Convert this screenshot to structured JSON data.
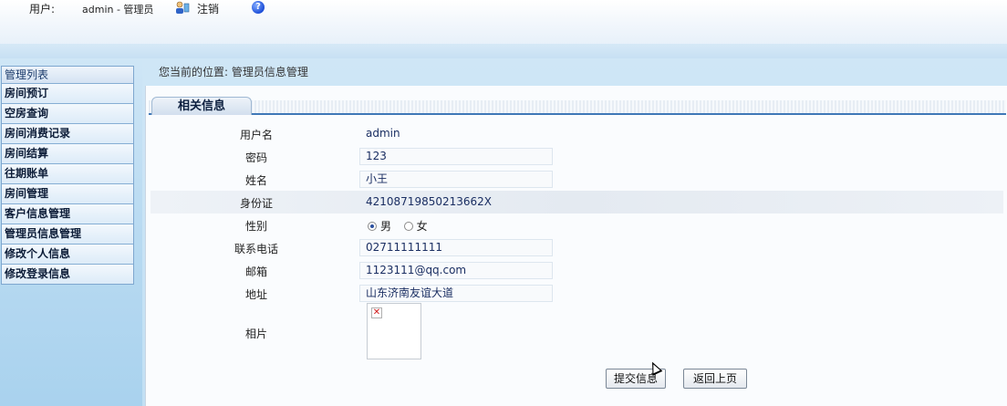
{
  "header": {
    "user_label": "用户:",
    "user_value": "admin - 管理员",
    "logout_label": "注销",
    "help_glyph": "?"
  },
  "sidebar": {
    "title": "管理列表",
    "items": [
      {
        "label": "房间预订"
      },
      {
        "label": "空房查询"
      },
      {
        "label": "房间消费记录"
      },
      {
        "label": "房间结算"
      },
      {
        "label": "往期账单"
      },
      {
        "label": "房间管理"
      },
      {
        "label": "客户信息管理"
      },
      {
        "label": "管理员信息管理"
      },
      {
        "label": "修改个人信息"
      },
      {
        "label": "修改登录信息"
      }
    ]
  },
  "breadcrumb": "您当前的位置: 管理员信息管理",
  "panel": {
    "title": "相关信息"
  },
  "form": {
    "username": {
      "label": "用户名",
      "value": "admin"
    },
    "password": {
      "label": "密码",
      "value": "123"
    },
    "name": {
      "label": "姓名",
      "value": "小王"
    },
    "id_card": {
      "label": "身份证",
      "value": "42108719850213662X"
    },
    "gender": {
      "label": "性别",
      "options": [
        "男",
        "女"
      ],
      "selected": "男"
    },
    "phone": {
      "label": "联系电话",
      "value": "02711111111"
    },
    "email": {
      "label": "邮箱",
      "value": "1123111@qq.com"
    },
    "address": {
      "label": "地址",
      "value": "山东济南友谊大道"
    },
    "photo": {
      "label": "相片"
    }
  },
  "buttons": {
    "submit": "提交信息",
    "back": "返回上页"
  },
  "icons": {
    "logout": "user-logout-icon",
    "help": "help-icon",
    "broken_image": "broken-image-icon"
  }
}
